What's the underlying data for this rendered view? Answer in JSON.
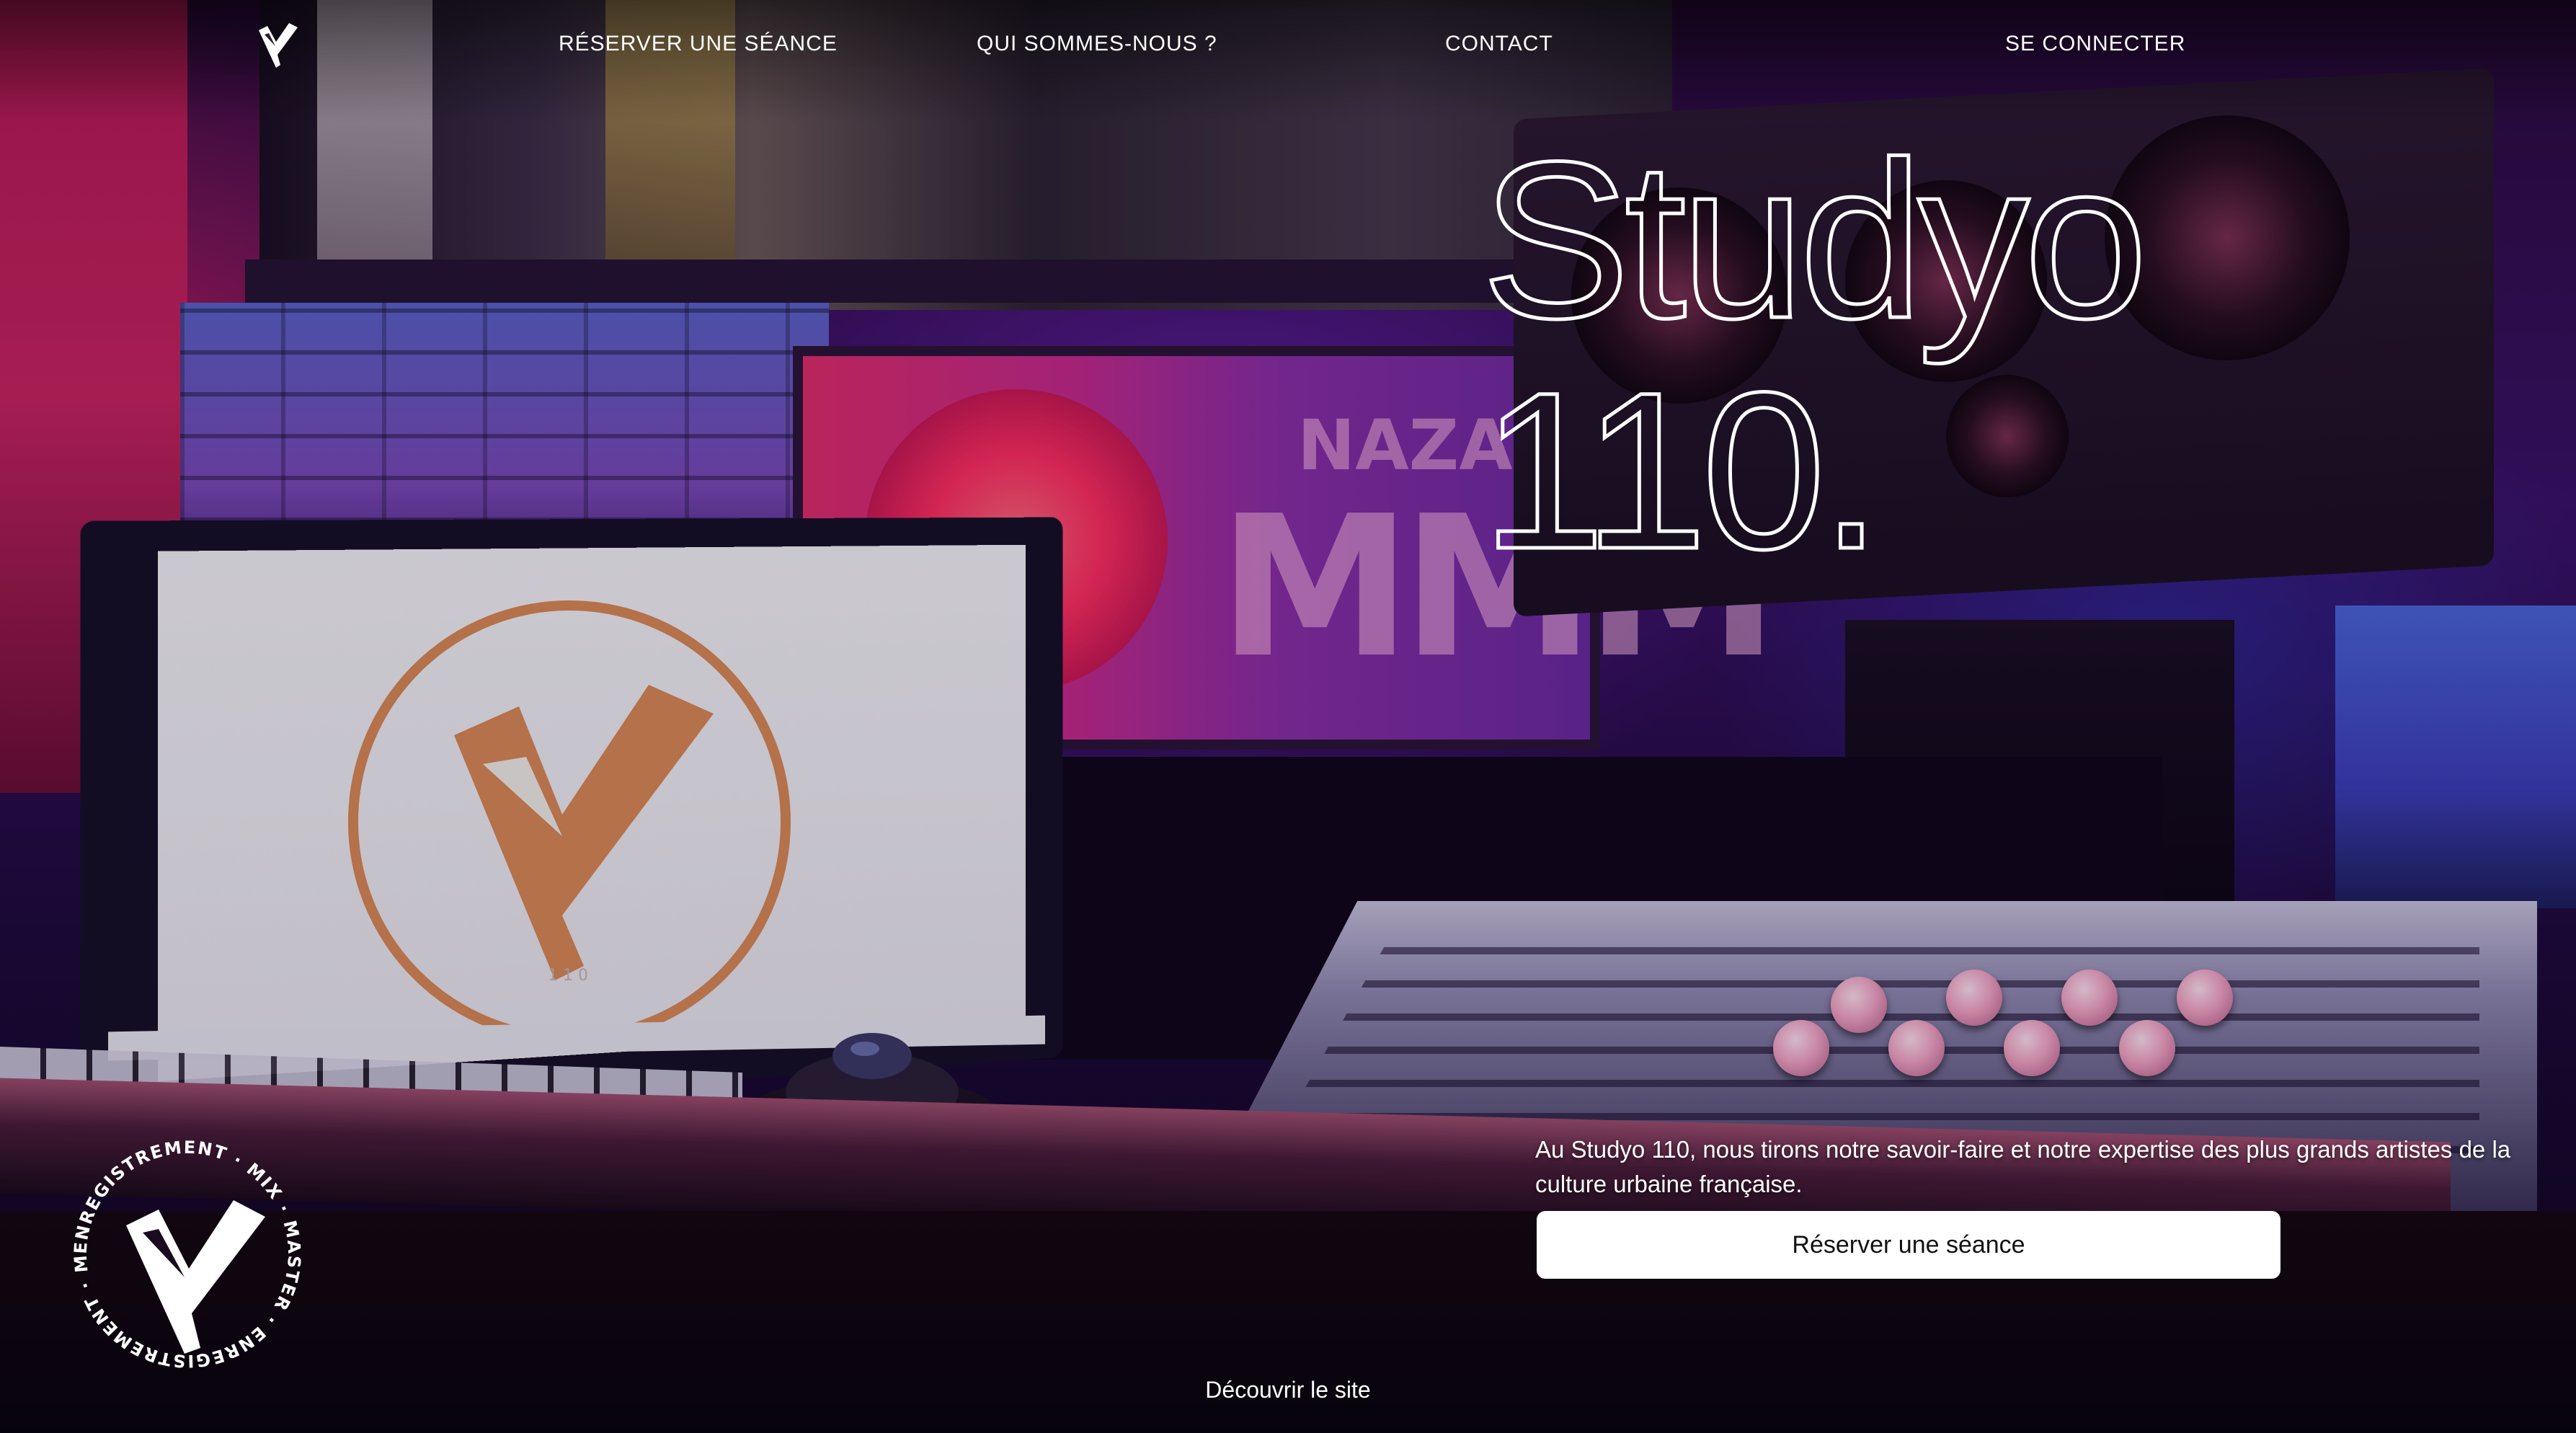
{
  "nav": {
    "brand_logo_icon": "studyo-110-logo-icon",
    "links": [
      {
        "label": "RÉSERVER UNE SÉANCE"
      },
      {
        "label": "QUI SOMMES-NOUS ?"
      },
      {
        "label": "CONTACT"
      },
      {
        "label": "SE CONNECTER"
      }
    ]
  },
  "hero": {
    "title_line1": "Studyo",
    "title_line2": "110.",
    "description": "Au Studyo 110, nous tirons notre savoir-faire et notre expertise des plus grands artistes de la culture urbaine française.",
    "cta_label": "Réserver une séance",
    "discover_label": "Découvrir le site"
  },
  "badge": {
    "ring_text": "ENREGISTREMENT · MIX · MASTER · ENREGISTREMENT · MIX · MASTER · ",
    "icon": "studyo-110-monogram-icon"
  },
  "background": {
    "poster_top_text": "NAZA",
    "poster_text": "MMM",
    "laptop_logo_caption": "1 1 0"
  },
  "colors": {
    "button_bg": "#ffffff",
    "button_text": "#111111",
    "text": "#ffffff",
    "screen_logo": "#d98a55"
  }
}
